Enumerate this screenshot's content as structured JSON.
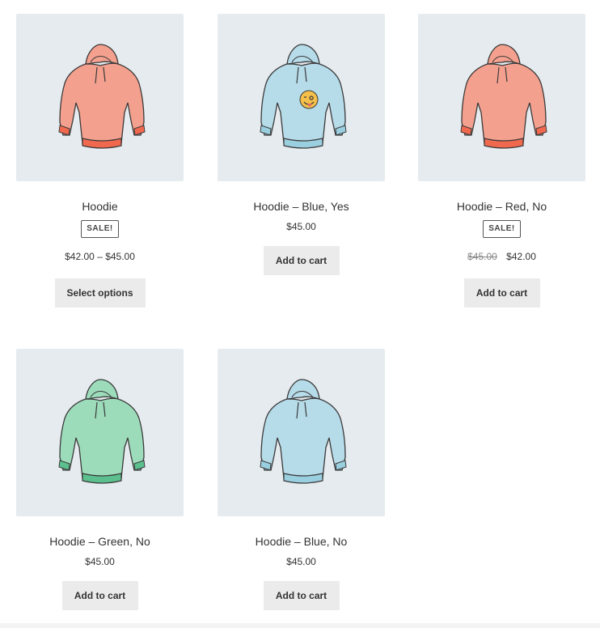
{
  "products": [
    {
      "title": "Hoodie",
      "badge": "SALE!",
      "price_from": "$42.00",
      "price_sep": "–",
      "price_to": "$45.00",
      "button": "Select options",
      "image": "hoodie-red-icon",
      "color": "#f2907e"
    },
    {
      "title": "Hoodie – Blue, Yes",
      "price": "$45.00",
      "button": "Add to cart",
      "image": "hoodie-blue-emoji-icon",
      "color": "#a9d6e6"
    },
    {
      "title": "Hoodie – Red, No",
      "badge": "SALE!",
      "regular_price": "$45.00",
      "sale_price": "$42.00",
      "button": "Add to cart",
      "image": "hoodie-red-icon",
      "color": "#f2907e"
    },
    {
      "title": "Hoodie – Green, No",
      "price": "$45.00",
      "button": "Add to cart",
      "image": "hoodie-green-icon",
      "color": "#8fd6b0"
    },
    {
      "title": "Hoodie – Blue, No",
      "price": "$45.00",
      "button": "Add to cart",
      "image": "hoodie-blue-icon",
      "color": "#a9d6e6"
    }
  ],
  "colors": {
    "thumb_bg": "#e6ebef",
    "button_bg": "#ebebeb",
    "red_hem": "#f0694f",
    "green_hem": "#5cc08e",
    "blue_hem": "#9acfe0"
  }
}
